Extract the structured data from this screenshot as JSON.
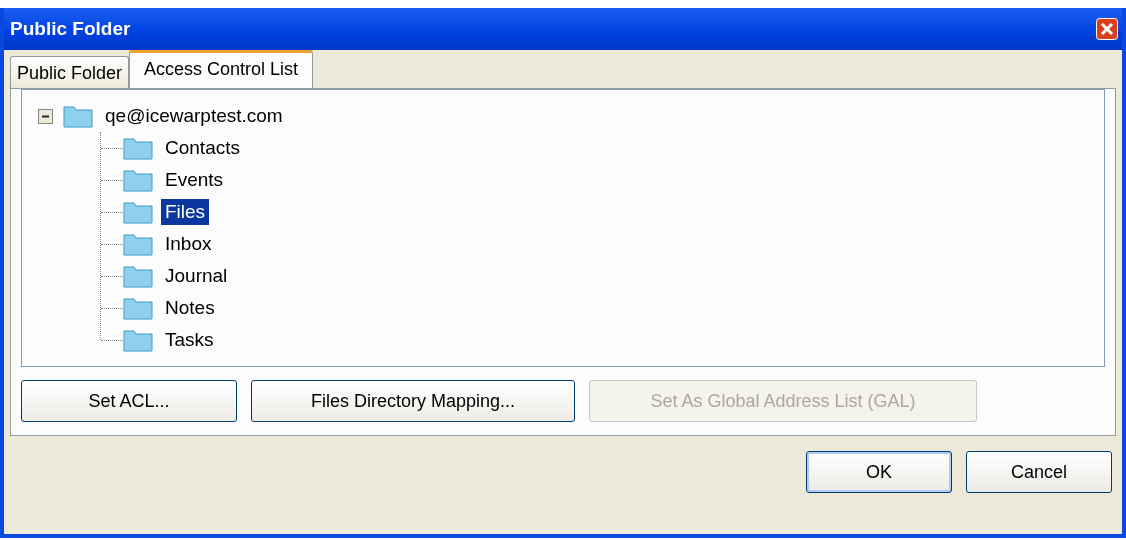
{
  "window": {
    "title": "Public Folder"
  },
  "tabs": [
    {
      "label": "Public Folder",
      "selected": false
    },
    {
      "label": "Access Control List",
      "selected": true
    }
  ],
  "tree": {
    "label": "qe@icewarptest.com",
    "expanded": true,
    "selected": false,
    "children": [
      {
        "label": "Contacts",
        "selected": false
      },
      {
        "label": "Events",
        "selected": false
      },
      {
        "label": "Files",
        "selected": true
      },
      {
        "label": "Inbox",
        "selected": false
      },
      {
        "label": "Journal",
        "selected": false
      },
      {
        "label": "Notes",
        "selected": false
      },
      {
        "label": "Tasks",
        "selected": false
      }
    ]
  },
  "actions": [
    {
      "label": "Set ACL...",
      "disabled": false
    },
    {
      "label": "Files Directory Mapping...",
      "disabled": false
    },
    {
      "label": "Set As Global Address List (GAL)",
      "disabled": true
    }
  ],
  "buttons": [
    {
      "label": "OK",
      "default": true
    },
    {
      "label": "Cancel",
      "default": false
    }
  ]
}
